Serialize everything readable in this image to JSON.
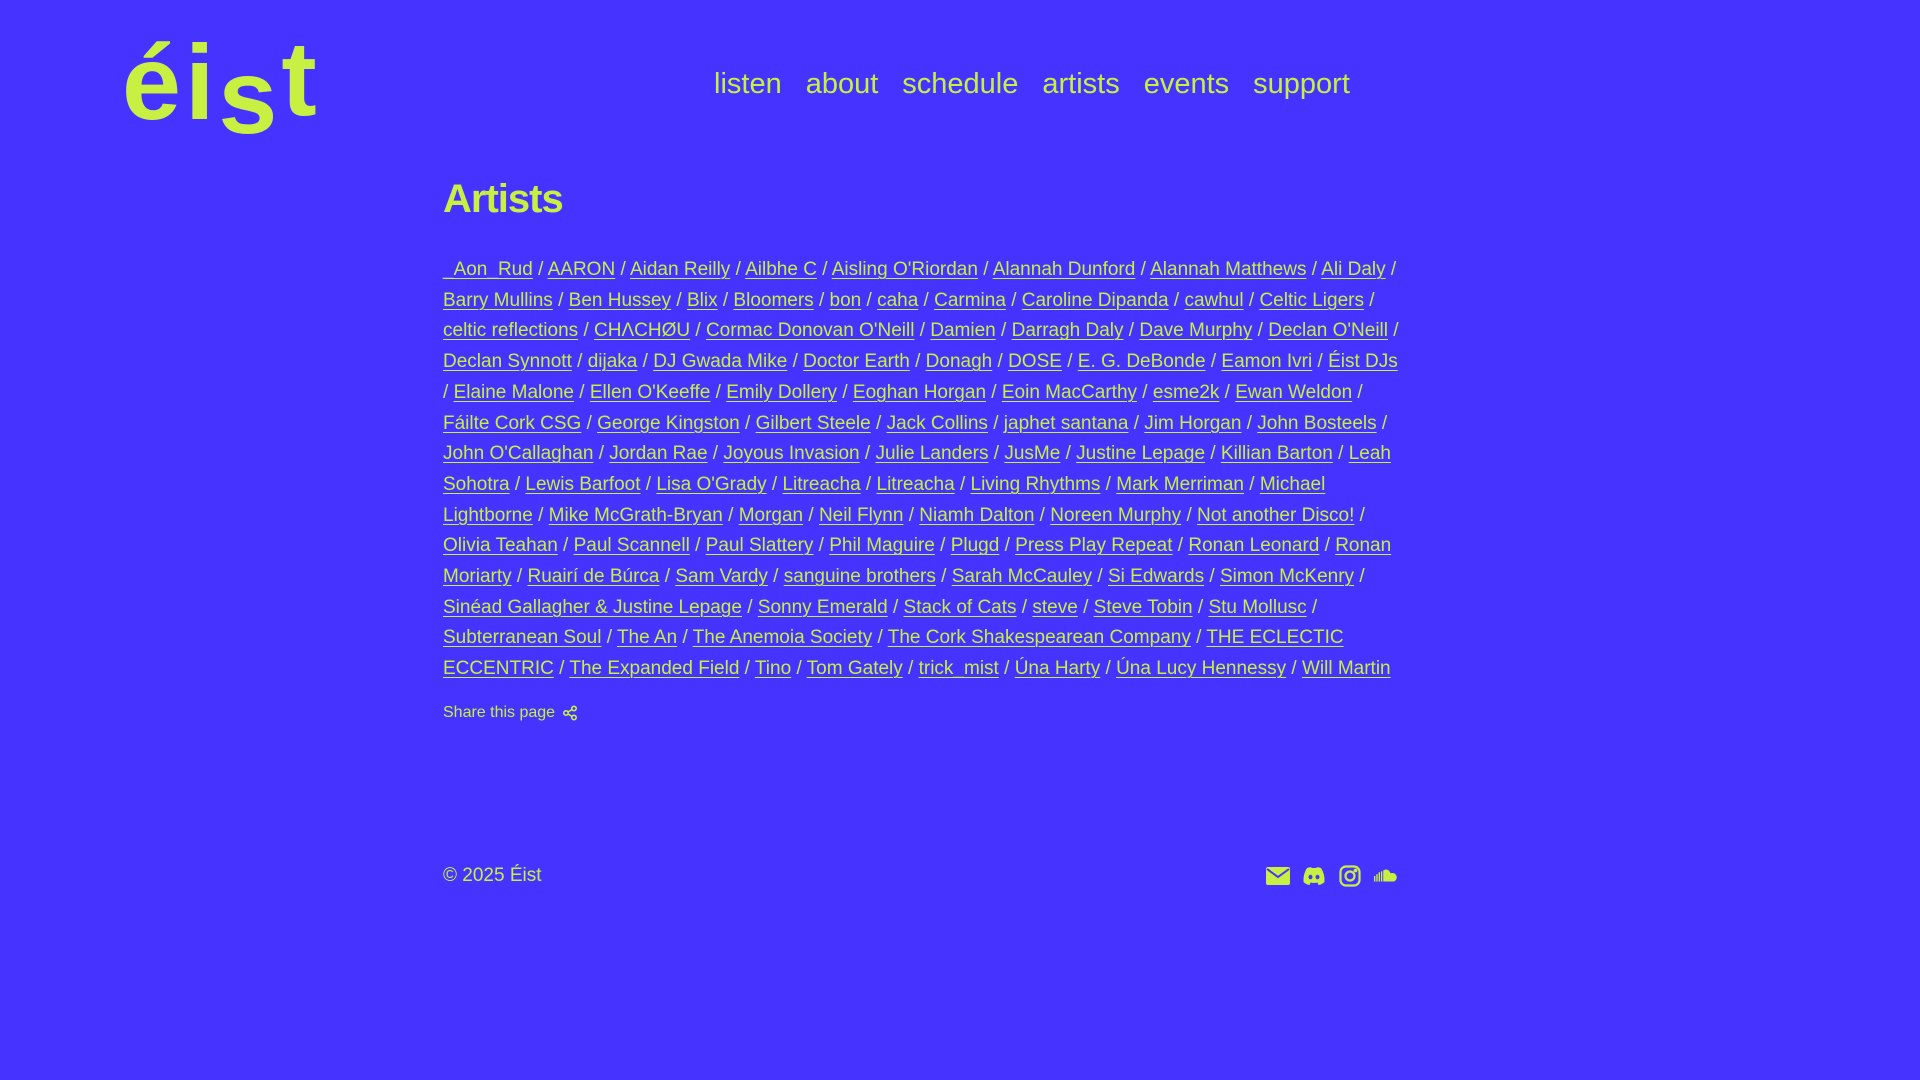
{
  "site": {
    "logo": "éist"
  },
  "nav": {
    "items": [
      "listen",
      "about",
      "schedule",
      "artists",
      "events",
      "support"
    ]
  },
  "page": {
    "title": "Artists",
    "share_label": "Share this page"
  },
  "artists": [
    "_Aon_Rud",
    "AARON",
    "Aidan Reilly",
    "Ailbhe C",
    "Aisling O'Riordan",
    "Alannah Dunford",
    "Alannah Matthews",
    "Ali Daly",
    "Barry Mullins",
    "Ben Hussey",
    "Blix",
    "Bloomers",
    "bon",
    "caha",
    "Carmina",
    "Caroline Dipanda",
    "cawhul",
    "Celtic Ligers",
    "celtic reflections",
    "CHΛCHØU",
    "Cormac Donovan O'Neill",
    "Damien",
    "Darragh Daly",
    "Dave Murphy",
    "Declan O'Neill",
    "Declan Synnott",
    "dijaka",
    "DJ Gwada Mike",
    "Doctor Earth",
    "Donagh",
    "DOSE",
    "E. G. DeBonde",
    "Eamon Ivri",
    "Éist DJs",
    "Elaine Malone",
    "Ellen O'Keeffe",
    "Emily Dollery",
    "Eoghan Horgan",
    "Eoin MacCarthy",
    "esme2k",
    "Ewan Weldon",
    "Fáilte Cork CSG",
    "George Kingston",
    "Gilbert Steele",
    "Jack Collins",
    "japhet santana",
    "Jim Horgan",
    "John Bosteels",
    "John O'Callaghan",
    "Jordan Rae",
    "Joyous Invasion",
    "Julie Landers",
    "JusMe",
    "Justine Lepage",
    "Killian Barton",
    "Leah Sohotra",
    "Lewis Barfoot",
    "Lisa O'Grady",
    "Litreacha",
    "Litreacha",
    "Living Rhythms",
    "Mark Merriman",
    "Michael Lightborne",
    "Mike McGrath-Bryan",
    "Morgan",
    "Neil Flynn",
    "Niamh Dalton",
    "Noreen Murphy",
    "Not another Disco!",
    "Olivia Teahan",
    "Paul Scannell",
    "Paul Slattery",
    "Phil Maguire",
    "Plugd",
    "Press Play Repeat",
    "Ronan Leonard",
    "Ronan Moriarty",
    "Ruairí de Búrca",
    "Sam Vardy",
    "sanguine brothers",
    "Sarah McCauley",
    "Si Edwards",
    "Simon McKenry",
    "Sinéad Gallagher & Justine Lepage",
    "Sonny Emerald",
    "Stack of Cats",
    "steve",
    "Steve Tobin",
    "Stu Mollusc",
    "Subterranean Soul",
    "The An",
    "The Anemoia Society",
    "The Cork Shakespearean Company",
    "THE ECLECTIC ECCENTRIC",
    "The Expanded Field",
    "Tino",
    "Tom Gately",
    "trick_mist",
    "Úna Harty",
    "Úna Lucy Hennessy",
    "Will Martin"
  ],
  "separator": " / ",
  "footer": {
    "copyright": "© 2025 Éist",
    "social_icons": [
      "email-icon",
      "discord-icon",
      "instagram-icon",
      "soundcloud-icon"
    ]
  },
  "colors": {
    "background": "#4733ff",
    "accent": "#c7f042"
  }
}
